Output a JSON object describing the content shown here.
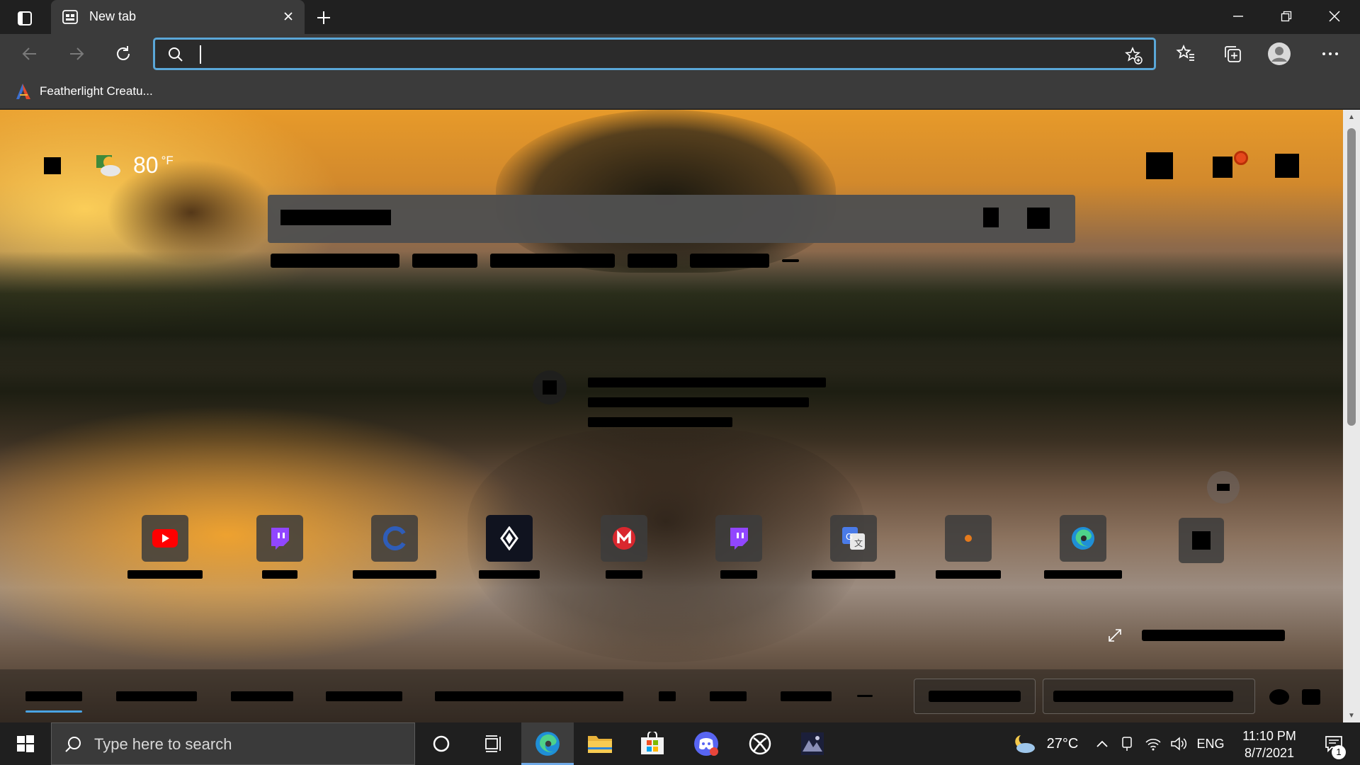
{
  "browser": {
    "tab": {
      "title": "New tab"
    },
    "address_bar": {
      "value": "",
      "placeholder": ""
    },
    "favorites_bar": {
      "items": [
        {
          "label": "Featherlight Creatu..."
        }
      ]
    }
  },
  "newtab": {
    "weather": {
      "temperature": "80",
      "unit": "°F"
    },
    "notification_dot_color": "#e6481c"
  },
  "taskbar": {
    "search_placeholder": "Type here to search",
    "weather": {
      "temperature": "27°C"
    },
    "language": "ENG",
    "time": "11:10 PM",
    "date": "8/7/2021",
    "notification_count": "1",
    "apps": [
      "cortana-icon",
      "task-view-icon",
      "edge-icon",
      "file-explorer-icon",
      "microsoft-store-icon",
      "discord-icon",
      "xbox-icon",
      "game-icon"
    ]
  },
  "colors": {
    "accent": "#5aa7d8",
    "tab_active": "#3b3b3b",
    "titlebar": "#202020",
    "taskbar": "#1f1f1f"
  }
}
